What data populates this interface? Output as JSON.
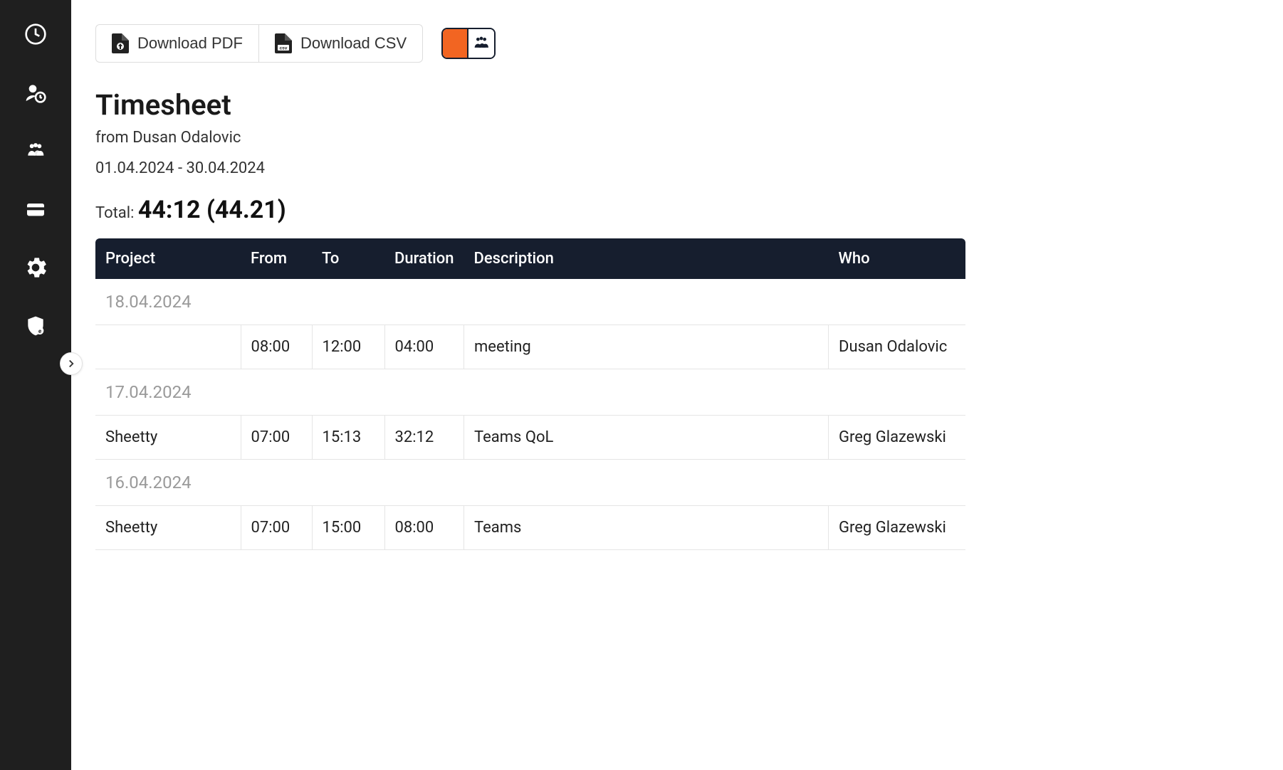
{
  "toolbar": {
    "download_pdf_label": "Download PDF",
    "download_csv_label": "Download CSV"
  },
  "header": {
    "title": "Timesheet",
    "subtitle_prefix": "from ",
    "person": "Dusan Odalovic",
    "date_range": "01.04.2024 - 30.04.2024",
    "total_label": "Total: ",
    "total_value": "44:12 (44.21)"
  },
  "columns": {
    "project": "Project",
    "from": "From",
    "to": "To",
    "duration": "Duration",
    "description": "Description",
    "who": "Who"
  },
  "groups": [
    {
      "date": "18.04.2024",
      "rows": [
        {
          "project": "",
          "from": "08:00",
          "to": "12:00",
          "duration": "04:00",
          "description": "meeting",
          "who": "Dusan Odalovic"
        }
      ]
    },
    {
      "date": "17.04.2024",
      "rows": [
        {
          "project": "Sheetty",
          "from": "07:00",
          "to": "15:13",
          "duration": "32:12",
          "description": "Teams QoL",
          "who": "Greg Glazewski"
        }
      ]
    },
    {
      "date": "16.04.2024",
      "rows": [
        {
          "project": "Sheetty",
          "from": "07:00",
          "to": "15:00",
          "duration": "08:00",
          "description": "Teams",
          "who": "Greg Glazewski"
        }
      ]
    }
  ]
}
